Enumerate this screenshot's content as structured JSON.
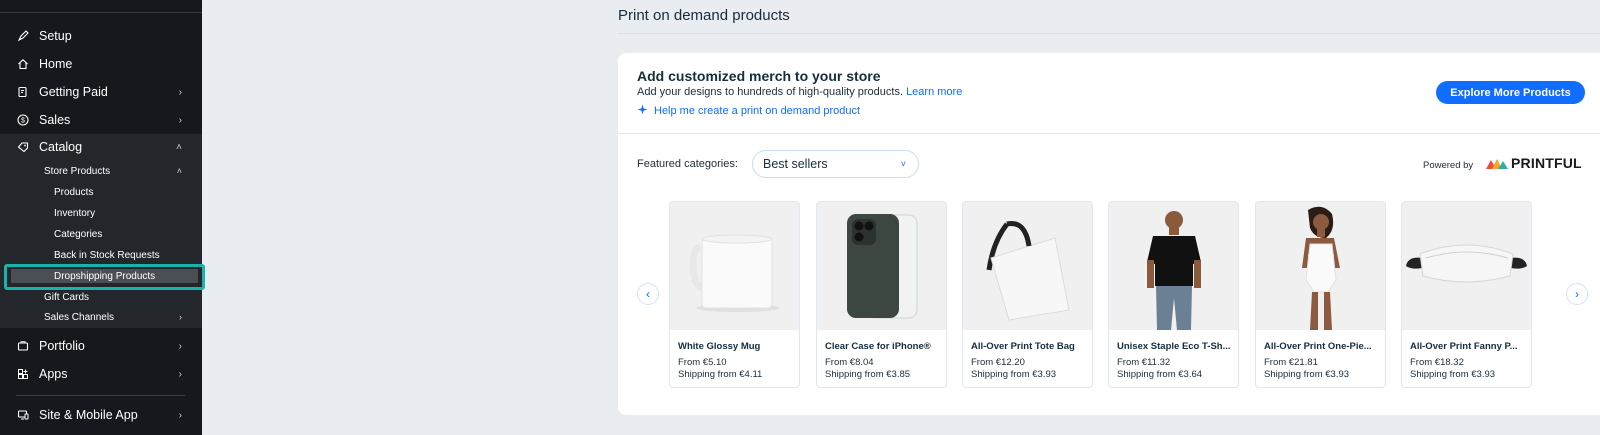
{
  "sidebar": {
    "items": [
      {
        "label": "Setup",
        "icon": "rocket-icon"
      },
      {
        "label": "Home",
        "icon": "home-icon"
      },
      {
        "label": "Getting Paid",
        "icon": "receipt-icon"
      },
      {
        "label": "Sales",
        "icon": "dollar-icon"
      },
      {
        "label": "Catalog",
        "icon": "tag-icon"
      },
      {
        "label": "Portfolio",
        "icon": "portfolio-icon"
      },
      {
        "label": "Apps",
        "icon": "apps-icon"
      },
      {
        "label": "Site & Mobile App",
        "icon": "monitor-icon"
      }
    ],
    "catalog_sub": {
      "store_products": "Store Products",
      "products": "Products",
      "inventory": "Inventory",
      "categories": "Categories",
      "back_in_stock": "Back in Stock Requests",
      "dropshipping": "Dropshipping Products",
      "gift_cards": "Gift Cards",
      "sales_channels": "Sales Channels"
    }
  },
  "main": {
    "title": "Print on demand products",
    "card": {
      "heading": "Add customized merch to your store",
      "subtitle": "Add your designs to hundreds of high-quality products.",
      "learn_more": "Learn more",
      "help_link": "Help me create a print on demand product",
      "explore_button": "Explore More Products",
      "featured_label": "Featured categories:",
      "featured_value": "Best sellers",
      "powered_by": "Powered by",
      "brand": "PRINTFUL"
    },
    "products": [
      {
        "name": "White Glossy Mug",
        "price": "From €5.10",
        "shipping": "Shipping from €4.11"
      },
      {
        "name": "Clear Case for iPhone®",
        "price": "From €8.04",
        "shipping": "Shipping from €3.85"
      },
      {
        "name": "All-Over Print Tote Bag",
        "price": "From €12.20",
        "shipping": "Shipping from €3.93"
      },
      {
        "name": "Unisex Staple Eco T-Sh...",
        "price": "From €11.32",
        "shipping": "Shipping from €3.64"
      },
      {
        "name": "All-Over Print One-Pie...",
        "price": "From €21.81",
        "shipping": "Shipping from €3.93"
      },
      {
        "name": "All-Over Print Fanny P...",
        "price": "From €18.32",
        "shipping": "Shipping from €3.93"
      }
    ]
  },
  "colors": {
    "accent": "#116dff",
    "sidebar_bg": "#15181c",
    "highlight": "#19b3ad"
  }
}
